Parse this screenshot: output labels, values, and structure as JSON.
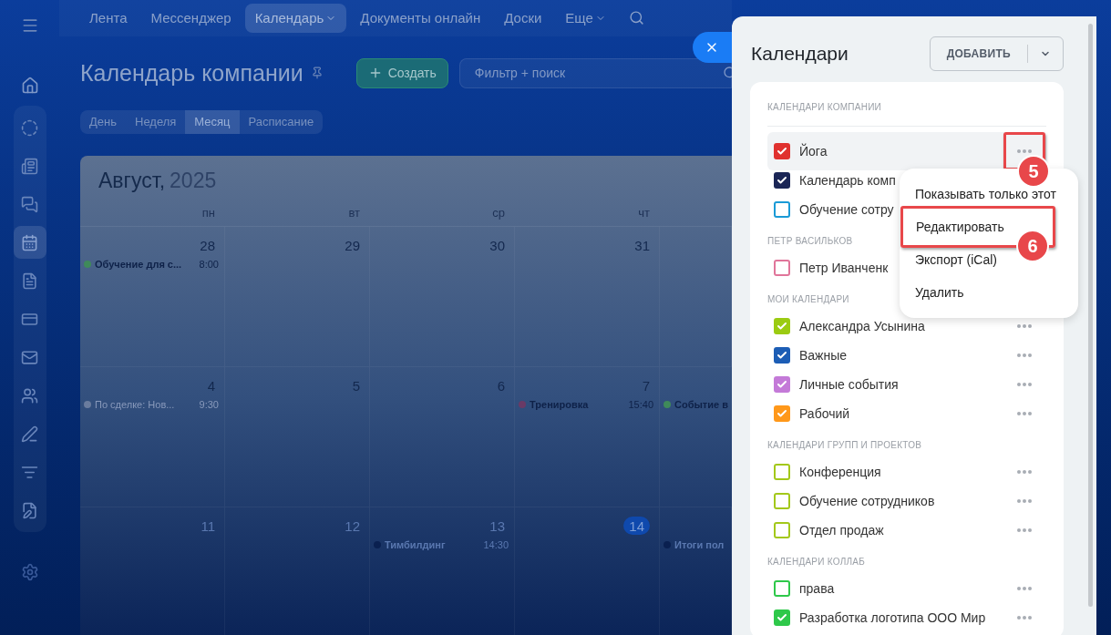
{
  "top_nav": {
    "items": [
      {
        "label": "Лента",
        "selected": false,
        "has_menu": false
      },
      {
        "label": "Мессенджер",
        "selected": false,
        "has_menu": false
      },
      {
        "label": "Календарь",
        "selected": true,
        "has_menu": true
      },
      {
        "label": "Документы онлайн",
        "selected": false,
        "has_menu": false
      },
      {
        "label": "Доски",
        "selected": false,
        "has_menu": false
      },
      {
        "label": "Еще",
        "selected": false,
        "has_menu": true
      }
    ]
  },
  "sidebar": {
    "items": [
      {
        "selected": false
      },
      {
        "selected": false
      },
      {
        "selected": false
      },
      {
        "selected": true
      },
      {
        "selected": false
      },
      {
        "selected": false
      },
      {
        "selected": false
      },
      {
        "selected": false
      },
      {
        "selected": false
      },
      {
        "selected": false
      },
      {
        "selected": false
      }
    ]
  },
  "header": {
    "title": "Календарь компании",
    "create_button": "Создать",
    "search": {
      "placeholder": "Фильтр + поиск"
    }
  },
  "view_tabs": [
    {
      "label": "День",
      "selected": false
    },
    {
      "label": "Неделя",
      "selected": false
    },
    {
      "label": "Месяц",
      "selected": true
    },
    {
      "label": "Расписание",
      "selected": false
    }
  ],
  "calendar": {
    "month": "Август,",
    "year": "2025",
    "weekdays": [
      "пн",
      "вт",
      "ср",
      "чт"
    ],
    "weeks": [
      {
        "days": [
          {
            "number": "28",
            "today": false,
            "events": [
              {
                "title": "Обучение для с...",
                "time": "8:00",
                "color": "#3f8a5a",
                "dimmed": false
              }
            ]
          },
          {
            "number": "29",
            "today": false
          },
          {
            "number": "30",
            "today": false
          },
          {
            "number": "31",
            "today": false
          }
        ]
      },
      {
        "days": [
          {
            "number": "4",
            "today": false,
            "events": [
              {
                "title": "По сделке: Нов...",
                "time": "9:30",
                "color": "#6a7c9e",
                "dimmed": true
              }
            ]
          },
          {
            "number": "5",
            "today": false
          },
          {
            "number": "6",
            "today": false
          },
          {
            "number": "7",
            "today": false,
            "events": [
              {
                "title": "Тренировка",
                "time": "15:40",
                "color": "#6a3a66",
                "dimmed": false
              }
            ]
          },
          {
            "events": [
              {
                "title": "Событие в",
                "color": "#3f8a5a",
                "dimmed": false
              }
            ]
          }
        ]
      },
      {
        "days": [
          {
            "number": "11",
            "today": false
          },
          {
            "number": "12",
            "today": false
          },
          {
            "number": "13",
            "today": false,
            "events": [
              {
                "title": "Тимбилдинг",
                "time": "14:30",
                "color": "#0a2050",
                "dimmed": false
              }
            ]
          },
          {
            "number": "14",
            "today": true
          },
          {
            "events": [
              {
                "title": "Итоги пол",
                "color": "#0a2050",
                "dimmed": false
              }
            ]
          }
        ]
      }
    ]
  },
  "panel": {
    "title": "Календари",
    "add_button": "ДОБАВИТЬ",
    "sections": [
      {
        "title": "КАЛЕНДАРИ КОМПАНИИ",
        "items": [
          {
            "name": "Йога",
            "color": "#e0312f",
            "checked": true,
            "hovered": true,
            "more_button": true
          },
          {
            "name": "Календарь комп",
            "color": "#1b2656",
            "checked": true,
            "hovered": false
          },
          {
            "name": "Обучение сотру",
            "color": "#1a9ad6",
            "checked": false,
            "hovered": false
          }
        ]
      },
      {
        "title": "ПЕТР ВАСИЛЬКОВ",
        "items": [
          {
            "name": "Петр Иванченк",
            "color": "#e0759a",
            "checked": false,
            "hovered": false
          }
        ]
      },
      {
        "title": "МОИ КАЛЕНДАРИ",
        "items": [
          {
            "name": "Александра Усынина",
            "color": "#9bcb12",
            "checked": true,
            "hovered": false,
            "more_button": true
          },
          {
            "name": "Важные",
            "color": "#1c5db5",
            "checked": true,
            "hovered": false,
            "more_button": true
          },
          {
            "name": "Личные события",
            "color": "#c47ad8",
            "checked": true,
            "hovered": false,
            "more_button": true
          },
          {
            "name": "Рабочий",
            "color": "#ff981a",
            "checked": true,
            "hovered": false,
            "more_button": true
          }
        ]
      },
      {
        "title": "КАЛЕНДАРИ ГРУПП И ПРОЕКТОВ",
        "items": [
          {
            "name": "Конференция",
            "color": "#a3c81a",
            "checked": false,
            "hovered": false,
            "more_button": true
          },
          {
            "name": "Обучение сотрудников",
            "color": "#a3c81a",
            "checked": false,
            "hovered": false,
            "more_button": true
          },
          {
            "name": "Отдел продаж",
            "color": "#a3c81a",
            "checked": false,
            "hovered": false,
            "more_button": true
          }
        ]
      },
      {
        "title": "КАЛЕНДАРИ КОЛЛАБ",
        "items": [
          {
            "name": "права",
            "color": "#2ec84a",
            "checked": false,
            "hovered": false,
            "more_button": true
          },
          {
            "name": "Разработка логотипа ООО Мир",
            "color": "#2ec84a",
            "checked": true,
            "hovered": false,
            "more_button": true
          }
        ]
      }
    ],
    "context_menu": [
      "Показывать только этот",
      "Редактировать",
      "Экспорт (iCal)",
      "Удалить"
    ],
    "callouts": [
      {
        "number": "5"
      },
      {
        "number": "6"
      }
    ]
  }
}
